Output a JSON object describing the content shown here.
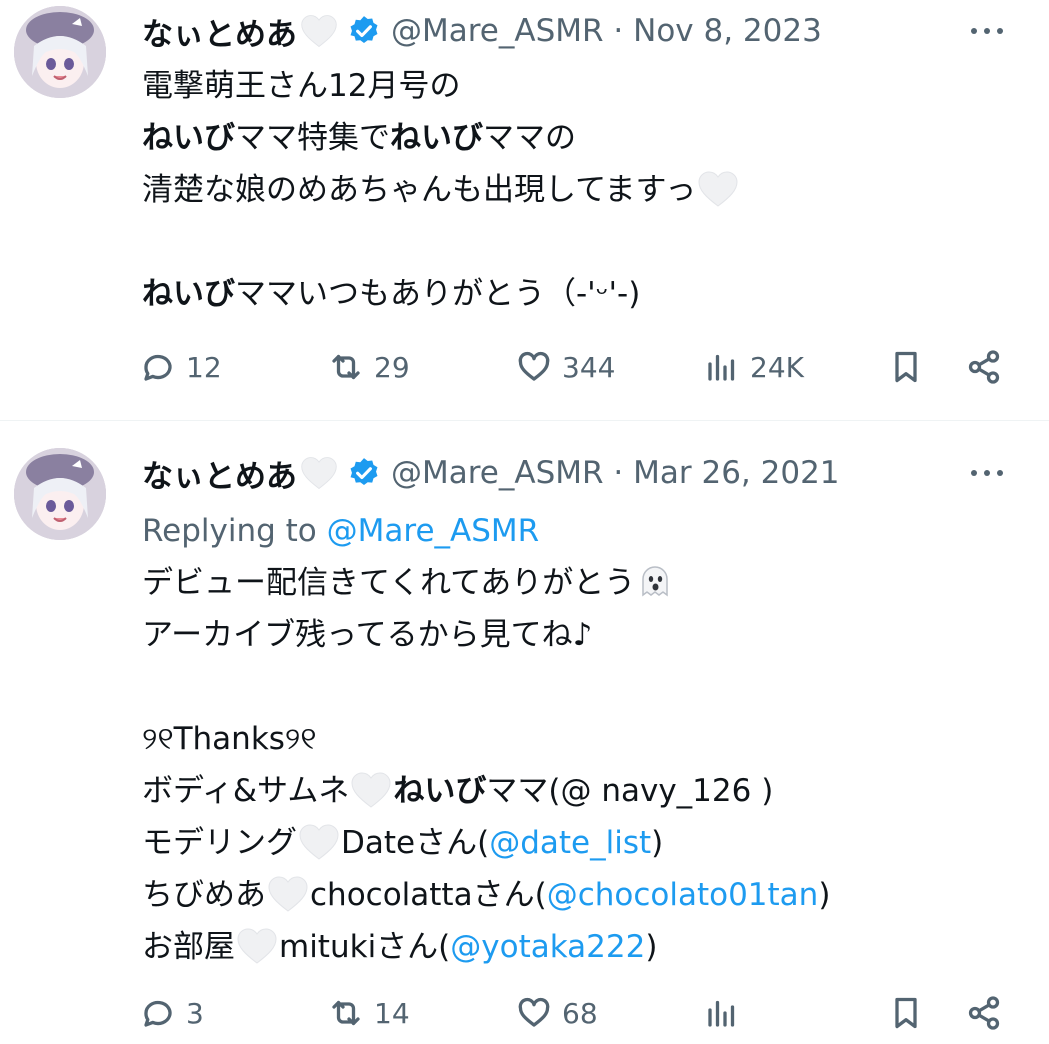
{
  "tweets": [
    {
      "author_name": "なぃとめあ",
      "handle": "@Mare_ASMR",
      "date": "Nov 8, 2023",
      "lines": {
        "l1": "電撃萌王さん12月号の",
        "l2_bold1": "ねいび",
        "l2_a": "ママ特集で",
        "l2_bold2": "ねいび",
        "l2_b": "ママの",
        "l3": "清楚な娘のめあちゃんも出現してますっ",
        "l5_bold": "ねいび",
        "l5": "ママいつもありがとう（-'ᵕ'-)"
      },
      "stats": {
        "replies": "12",
        "reposts": "29",
        "likes": "344",
        "views": "24K"
      }
    },
    {
      "author_name": "なぃとめあ",
      "handle": "@Mare_ASMR",
      "date": "Mar 26, 2021",
      "replying_label": "Replying to",
      "replying_handle": "@Mare_ASMR",
      "lines": {
        "l1": "デビュー配信きてくれてありがとう",
        "l2": "アーカイブ残ってるから見てね♪",
        "l4": "୨୧Thanks୨୧",
        "l5a": "ボディ&サムネ",
        "l5_bold": "ねいび",
        "l5b": "ママ(@ navy_126 )",
        "l6a": "モデリング",
        "l6b": "Dateさん(",
        "l6_link": "@date_list",
        "l6c": ")",
        "l7a": "ちびめあ",
        "l7b": "chocolattaさん(",
        "l7_link": "@chocolato01tan",
        "l7c": ")",
        "l8a": "お部屋",
        "l8b": "mitukiさん(",
        "l8_link": "@yotaka222",
        "l8c": ")"
      },
      "stats": {
        "replies": "3",
        "reposts": "14",
        "likes": "68",
        "views": ""
      }
    }
  ],
  "icons": [
    "reply-icon",
    "repost-icon",
    "like-icon",
    "views-icon",
    "bookmark-icon",
    "share-icon",
    "more-icon",
    "verified-badge-icon",
    "white-heart-emoji",
    "ghost-emoji"
  ],
  "colors": {
    "link": "#1d9bf0",
    "secondary_text": "#536471",
    "verified": "#1d9bf0",
    "text": "#0f1419"
  }
}
